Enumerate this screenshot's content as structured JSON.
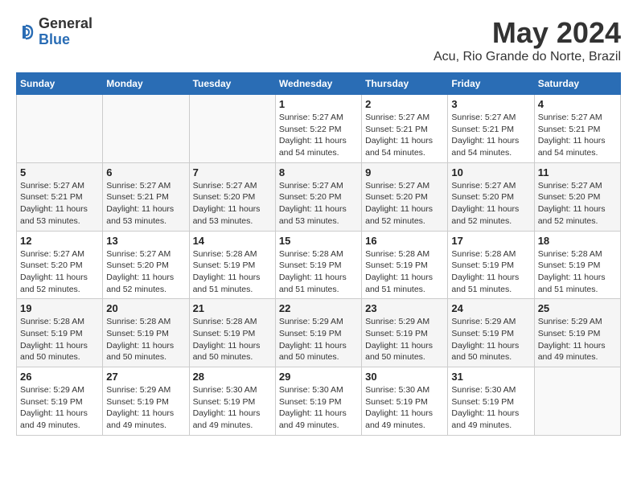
{
  "header": {
    "logo_general": "General",
    "logo_blue": "Blue",
    "month_title": "May 2024",
    "location": "Acu, Rio Grande do Norte, Brazil"
  },
  "weekdays": [
    "Sunday",
    "Monday",
    "Tuesday",
    "Wednesday",
    "Thursday",
    "Friday",
    "Saturday"
  ],
  "weeks": [
    [
      {
        "day": "",
        "info": ""
      },
      {
        "day": "",
        "info": ""
      },
      {
        "day": "",
        "info": ""
      },
      {
        "day": "1",
        "info": "Sunrise: 5:27 AM\nSunset: 5:22 PM\nDaylight: 11 hours\nand 54 minutes."
      },
      {
        "day": "2",
        "info": "Sunrise: 5:27 AM\nSunset: 5:21 PM\nDaylight: 11 hours\nand 54 minutes."
      },
      {
        "day": "3",
        "info": "Sunrise: 5:27 AM\nSunset: 5:21 PM\nDaylight: 11 hours\nand 54 minutes."
      },
      {
        "day": "4",
        "info": "Sunrise: 5:27 AM\nSunset: 5:21 PM\nDaylight: 11 hours\nand 54 minutes."
      }
    ],
    [
      {
        "day": "5",
        "info": "Sunrise: 5:27 AM\nSunset: 5:21 PM\nDaylight: 11 hours\nand 53 minutes."
      },
      {
        "day": "6",
        "info": "Sunrise: 5:27 AM\nSunset: 5:21 PM\nDaylight: 11 hours\nand 53 minutes."
      },
      {
        "day": "7",
        "info": "Sunrise: 5:27 AM\nSunset: 5:20 PM\nDaylight: 11 hours\nand 53 minutes."
      },
      {
        "day": "8",
        "info": "Sunrise: 5:27 AM\nSunset: 5:20 PM\nDaylight: 11 hours\nand 53 minutes."
      },
      {
        "day": "9",
        "info": "Sunrise: 5:27 AM\nSunset: 5:20 PM\nDaylight: 11 hours\nand 52 minutes."
      },
      {
        "day": "10",
        "info": "Sunrise: 5:27 AM\nSunset: 5:20 PM\nDaylight: 11 hours\nand 52 minutes."
      },
      {
        "day": "11",
        "info": "Sunrise: 5:27 AM\nSunset: 5:20 PM\nDaylight: 11 hours\nand 52 minutes."
      }
    ],
    [
      {
        "day": "12",
        "info": "Sunrise: 5:27 AM\nSunset: 5:20 PM\nDaylight: 11 hours\nand 52 minutes."
      },
      {
        "day": "13",
        "info": "Sunrise: 5:27 AM\nSunset: 5:20 PM\nDaylight: 11 hours\nand 52 minutes."
      },
      {
        "day": "14",
        "info": "Sunrise: 5:28 AM\nSunset: 5:19 PM\nDaylight: 11 hours\nand 51 minutes."
      },
      {
        "day": "15",
        "info": "Sunrise: 5:28 AM\nSunset: 5:19 PM\nDaylight: 11 hours\nand 51 minutes."
      },
      {
        "day": "16",
        "info": "Sunrise: 5:28 AM\nSunset: 5:19 PM\nDaylight: 11 hours\nand 51 minutes."
      },
      {
        "day": "17",
        "info": "Sunrise: 5:28 AM\nSunset: 5:19 PM\nDaylight: 11 hours\nand 51 minutes."
      },
      {
        "day": "18",
        "info": "Sunrise: 5:28 AM\nSunset: 5:19 PM\nDaylight: 11 hours\nand 51 minutes."
      }
    ],
    [
      {
        "day": "19",
        "info": "Sunrise: 5:28 AM\nSunset: 5:19 PM\nDaylight: 11 hours\nand 50 minutes."
      },
      {
        "day": "20",
        "info": "Sunrise: 5:28 AM\nSunset: 5:19 PM\nDaylight: 11 hours\nand 50 minutes."
      },
      {
        "day": "21",
        "info": "Sunrise: 5:28 AM\nSunset: 5:19 PM\nDaylight: 11 hours\nand 50 minutes."
      },
      {
        "day": "22",
        "info": "Sunrise: 5:29 AM\nSunset: 5:19 PM\nDaylight: 11 hours\nand 50 minutes."
      },
      {
        "day": "23",
        "info": "Sunrise: 5:29 AM\nSunset: 5:19 PM\nDaylight: 11 hours\nand 50 minutes."
      },
      {
        "day": "24",
        "info": "Sunrise: 5:29 AM\nSunset: 5:19 PM\nDaylight: 11 hours\nand 50 minutes."
      },
      {
        "day": "25",
        "info": "Sunrise: 5:29 AM\nSunset: 5:19 PM\nDaylight: 11 hours\nand 49 minutes."
      }
    ],
    [
      {
        "day": "26",
        "info": "Sunrise: 5:29 AM\nSunset: 5:19 PM\nDaylight: 11 hours\nand 49 minutes."
      },
      {
        "day": "27",
        "info": "Sunrise: 5:29 AM\nSunset: 5:19 PM\nDaylight: 11 hours\nand 49 minutes."
      },
      {
        "day": "28",
        "info": "Sunrise: 5:30 AM\nSunset: 5:19 PM\nDaylight: 11 hours\nand 49 minutes."
      },
      {
        "day": "29",
        "info": "Sunrise: 5:30 AM\nSunset: 5:19 PM\nDaylight: 11 hours\nand 49 minutes."
      },
      {
        "day": "30",
        "info": "Sunrise: 5:30 AM\nSunset: 5:19 PM\nDaylight: 11 hours\nand 49 minutes."
      },
      {
        "day": "31",
        "info": "Sunrise: 5:30 AM\nSunset: 5:19 PM\nDaylight: 11 hours\nand 49 minutes."
      },
      {
        "day": "",
        "info": ""
      }
    ]
  ]
}
